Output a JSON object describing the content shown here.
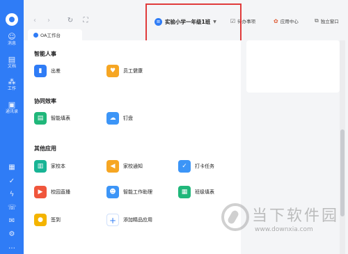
{
  "nav": {
    "items": [
      {
        "label": "消息",
        "icon": "chat-icon"
      },
      {
        "label": "文档",
        "icon": "document-icon"
      },
      {
        "label": "工作",
        "icon": "grid-icon"
      },
      {
        "label": "通讯录",
        "icon": "contacts-icon"
      }
    ],
    "bottom_icons": [
      "calendar-icon",
      "check-icon",
      "lightning-icon",
      "phone-icon",
      "mail-icon",
      "settings-icon",
      "more-icon"
    ]
  },
  "toolbar": {
    "school_name": "实验小学一年级1班",
    "todo_label": "待办事项",
    "app_center_label": "应用中心",
    "detach_label": "独立窗口"
  },
  "tab": {
    "label": "OA工作台"
  },
  "sections": {
    "hr": {
      "title": "智能人事",
      "apps": [
        {
          "name": "出差",
          "icon": "suitcase-icon"
        },
        {
          "name": "员工健康",
          "icon": "heart-icon"
        }
      ]
    },
    "collab": {
      "title": "协同效率",
      "apps": [
        {
          "name": "智能填表",
          "icon": "form-icon"
        },
        {
          "name": "钉盘",
          "icon": "cloud-icon"
        }
      ]
    },
    "other": {
      "title": "其他应用",
      "apps": [
        {
          "name": "家校本",
          "icon": "book-icon"
        },
        {
          "name": "家校通知",
          "icon": "megaphone-icon"
        },
        {
          "name": "打卡任务",
          "icon": "checkin-icon"
        },
        {
          "name": "校园直播",
          "icon": "tv-icon"
        },
        {
          "name": "智能工作助理",
          "icon": "robot-icon"
        },
        {
          "name": "班级填表",
          "icon": "table-icon"
        },
        {
          "name": "签到",
          "icon": "location-icon"
        },
        {
          "name": "添加精品应用",
          "icon": "plus-icon"
        }
      ]
    }
  },
  "watermark": {
    "brand": "当下软件园",
    "url": "www.downxia.com"
  }
}
